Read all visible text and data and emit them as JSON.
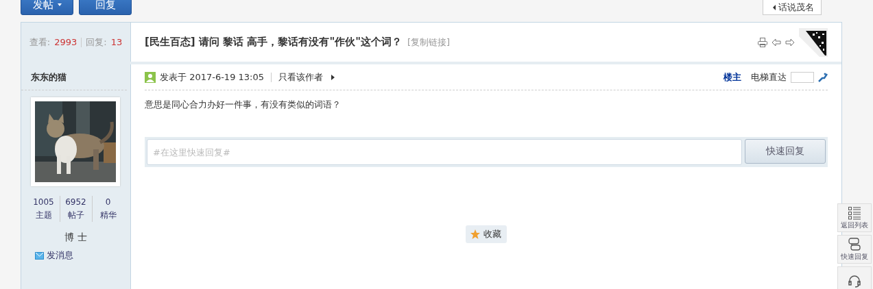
{
  "top_buttons": [
    {
      "label": "发帖",
      "dropdown": true
    },
    {
      "label": "回复",
      "dropdown": false
    }
  ],
  "breadcrumb_tab": {
    "label": "话说茂名"
  },
  "stats": {
    "views_label": "查看:",
    "views": "2993",
    "replies_label": "回复:",
    "replies": "13"
  },
  "thread": {
    "title": "[民生百态] 请问 黎话 高手，黎话有没有\"作伙\"这个词？",
    "copy_link": "[复制链接]"
  },
  "author": {
    "name": "东东的猫",
    "stats": [
      {
        "value": "1005",
        "label": "主题"
      },
      {
        "value": "6952",
        "label": "帖子"
      },
      {
        "value": "0",
        "label": "精华"
      }
    ],
    "rank": "博 士",
    "message": "发消息"
  },
  "post": {
    "posted": "发表于 2017-6-19 13:05",
    "only_author": "只看该作者",
    "floor": "楼主",
    "jump_label": "电梯直达",
    "body": "意思是同心合力办好一件事，有没有类似的词语？"
  },
  "quick_reply": {
    "placeholder": "#在这里快速回复#",
    "button": "快速回复"
  },
  "favorite": "收藏",
  "side_tools": [
    {
      "kind": "list",
      "label": "返回列表"
    },
    {
      "kind": "reply",
      "label": "快速回复"
    },
    {
      "kind": "service"
    }
  ]
}
